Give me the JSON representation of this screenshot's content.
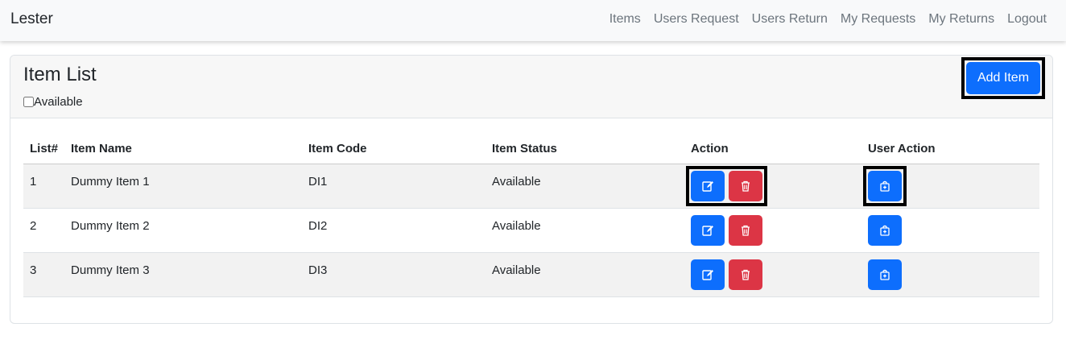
{
  "navbar": {
    "brand": "Lester",
    "links": [
      "Items",
      "Users Request",
      "Users Return",
      "My Requests",
      "My Returns",
      "Logout"
    ]
  },
  "card": {
    "title": "Item List",
    "filter_label": "Available",
    "add_button": "Add Item"
  },
  "table": {
    "headers": [
      "List#",
      "Item Name",
      "Item Code",
      "Item Status",
      "Action",
      "User Action"
    ],
    "rows": [
      {
        "num": "1",
        "name": "Dummy Item 1",
        "code": "DI1",
        "status": "Available"
      },
      {
        "num": "2",
        "name": "Dummy Item 2",
        "code": "DI2",
        "status": "Available"
      },
      {
        "num": "3",
        "name": "Dummy Item 3",
        "code": "DI3",
        "status": "Available"
      }
    ]
  },
  "icons": {
    "edit": "edit-icon",
    "delete": "trash-icon",
    "request": "bag-plus-icon"
  },
  "colors": {
    "primary": "#0d6efd",
    "danger": "#dc3545",
    "navbar_bg": "#f8f9fa"
  }
}
